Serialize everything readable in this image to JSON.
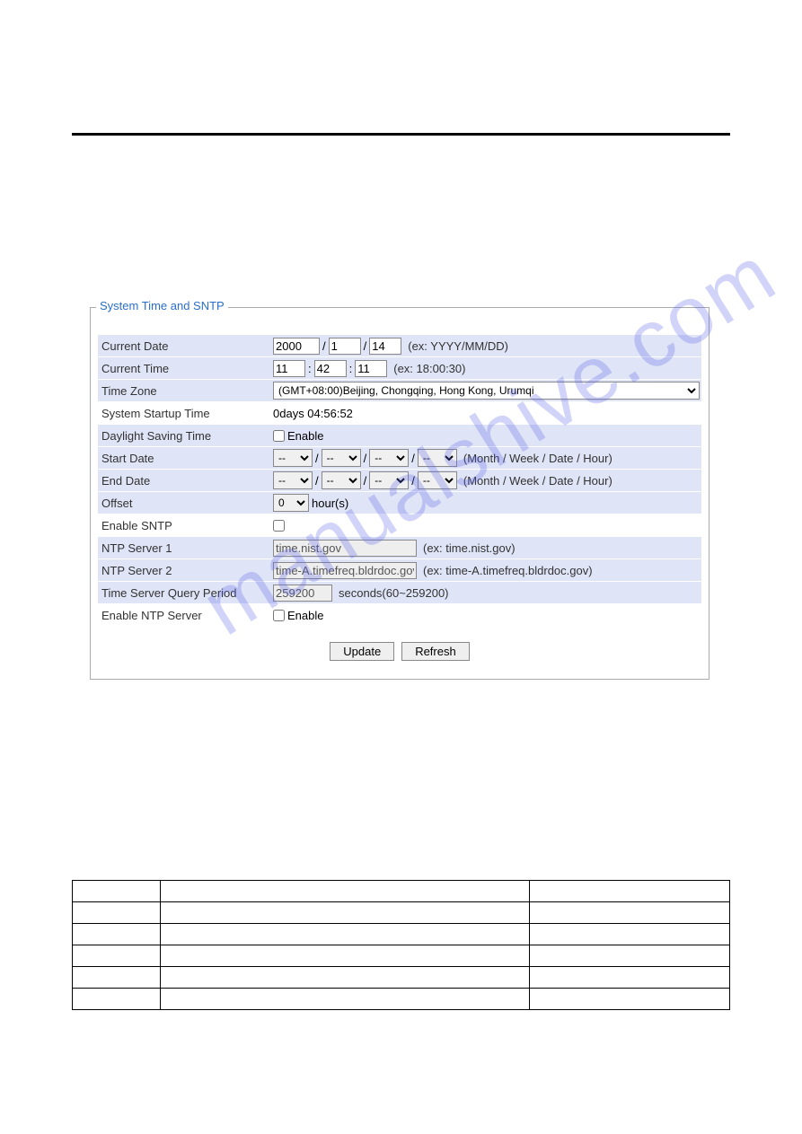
{
  "panel": {
    "legend": "System Time and SNTP",
    "currentDate": {
      "label": "Current Date",
      "year": "2000",
      "month": "1",
      "day": "14",
      "hint": "(ex: YYYY/MM/DD)"
    },
    "currentTime": {
      "label": "Current Time",
      "hour": "11",
      "minute": "42",
      "second": "11",
      "hint": "(ex: 18:00:30)"
    },
    "timeZone": {
      "label": "Time Zone",
      "value": "(GMT+08:00)Beijing, Chongqing, Hong Kong, Urumqi"
    },
    "startupTime": {
      "label": "System Startup Time",
      "value": "0days 04:56:52"
    },
    "dst": {
      "label": "Daylight Saving Time",
      "checkLabel": "Enable"
    },
    "startDate": {
      "label": "Start Date",
      "placeholder": "--",
      "hint": "(Month / Week / Date / Hour)"
    },
    "endDate": {
      "label": "End Date",
      "placeholder": "--",
      "hint": "(Month / Week / Date / Hour)"
    },
    "offset": {
      "label": "Offset",
      "value": "0",
      "unit": "hour(s)"
    },
    "enableSntp": {
      "label": "Enable SNTP"
    },
    "ntp1": {
      "label": "NTP Server 1",
      "value": "time.nist.gov",
      "hint": "(ex: time.nist.gov)"
    },
    "ntp2": {
      "label": "NTP Server 2",
      "value": "time-A.timefreq.bldrdoc.gov",
      "hint": "(ex: time-A.timefreq.bldrdoc.gov)"
    },
    "queryPeriod": {
      "label": "Time Server Query Period",
      "value": "259200",
      "hint": "seconds(60~259200)"
    },
    "enableNtpServer": {
      "label": "Enable NTP Server",
      "checkLabel": "Enable"
    },
    "buttons": {
      "update": "Update",
      "refresh": "Refresh"
    }
  },
  "separators": {
    "slash": "/",
    "colon": ":"
  },
  "watermark": "manualshive.com"
}
